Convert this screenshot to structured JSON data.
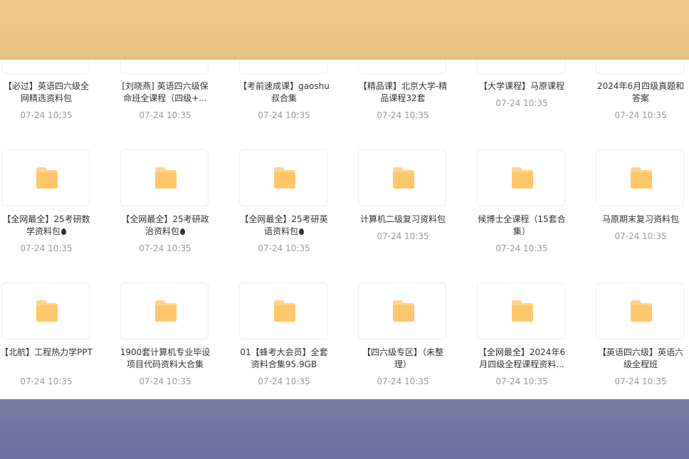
{
  "rows": [
    {
      "items": [
        {
          "name": "【必过】英语四六级全网精选资料包",
          "date": "07-24 10:35"
        },
        {
          "name": "[刘晓燕] 英语四六级保命班全课程（四级+...",
          "date": "07-24 10:35"
        },
        {
          "name": "【考前速成课】gaoshu叔合集",
          "date": "07-24 10:35"
        },
        {
          "name": "【精品课】北京大学-精品课程32套",
          "date": "07-24 10:35"
        },
        {
          "name": "【大学课程】马原课程",
          "date": "07-24 10:35"
        },
        {
          "name": "2024年6月四级真题和答案",
          "date": "07-24 10:35"
        }
      ]
    },
    {
      "items": [
        {
          "name": "【全网最全】25考研数学资料包",
          "date": "07-24 10:35",
          "drop": true
        },
        {
          "name": "【全网最全】25考研政治资料包",
          "date": "07-24 10:35",
          "drop": true
        },
        {
          "name": "【全网最全】25考研英语资料包",
          "date": "07-24 10:35",
          "drop": true
        },
        {
          "name": "计算机二级复习资料包",
          "date": "07-24 10:35"
        },
        {
          "name": "候博士全课程（15套合集）",
          "date": "07-24 10:35"
        },
        {
          "name": "马原期末复习资料包",
          "date": "07-24 10:35"
        }
      ]
    },
    {
      "items": [
        {
          "name": "【北航】工程热力学PPT",
          "date": "07-24 10:35"
        },
        {
          "name": "1900套计算机专业毕设项目代码资料大合集",
          "date": "07-24 10:35"
        },
        {
          "name": "01【蜂考大会员】全套资料合集95.9GB",
          "date": "07-24 10:35"
        },
        {
          "name": "【四六级专区】（未整理）",
          "date": "07-24 10:35"
        },
        {
          "name": "【全网最全】2024年6月四级全程课程资料...",
          "date": "07-24 10:35"
        },
        {
          "name": "【英语四六级】英语六级全程班",
          "date": "07-24 10:35"
        }
      ]
    }
  ],
  "colors": {
    "top_band": "#e8c488",
    "bottom_band": "#7174a0",
    "folder": "#ffc76a"
  }
}
